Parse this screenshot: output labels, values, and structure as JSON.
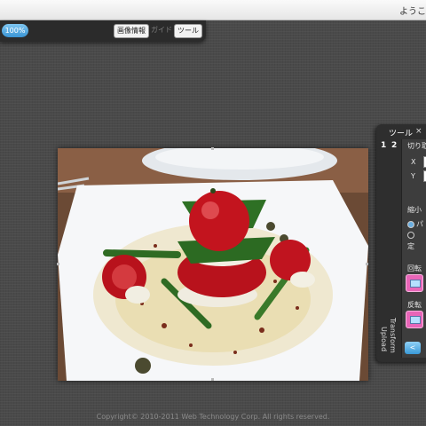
{
  "header": {
    "greeting": "ようこ"
  },
  "toolbar": {
    "zoom": "100%",
    "buttons": [
      {
        "label": "画像情報",
        "active": true
      },
      {
        "label": "ガイド",
        "active": false
      },
      {
        "label": "ツール",
        "active": true
      }
    ]
  },
  "canvas": {
    "image": "photo of caprese salad stack on white plate"
  },
  "tool_panel": {
    "title": "ツール",
    "close": "×",
    "tabs": [
      "1",
      "2"
    ],
    "crop_label": "切り取",
    "x_label": "X",
    "y_label": "Y",
    "resize_label": "縮小",
    "option_1": "パ",
    "option_2": "定",
    "rotate_label": "回転",
    "flip_label": "反転",
    "transform_label": "Transform",
    "upload_label": "Upload",
    "back_button": "<"
  },
  "footer": {
    "copyright": "Copyright© 2010-2011 Web Technology Corp. All rights reserved."
  },
  "colors": {
    "accent": "#3a94d4",
    "tool_button": "#e866b8"
  }
}
